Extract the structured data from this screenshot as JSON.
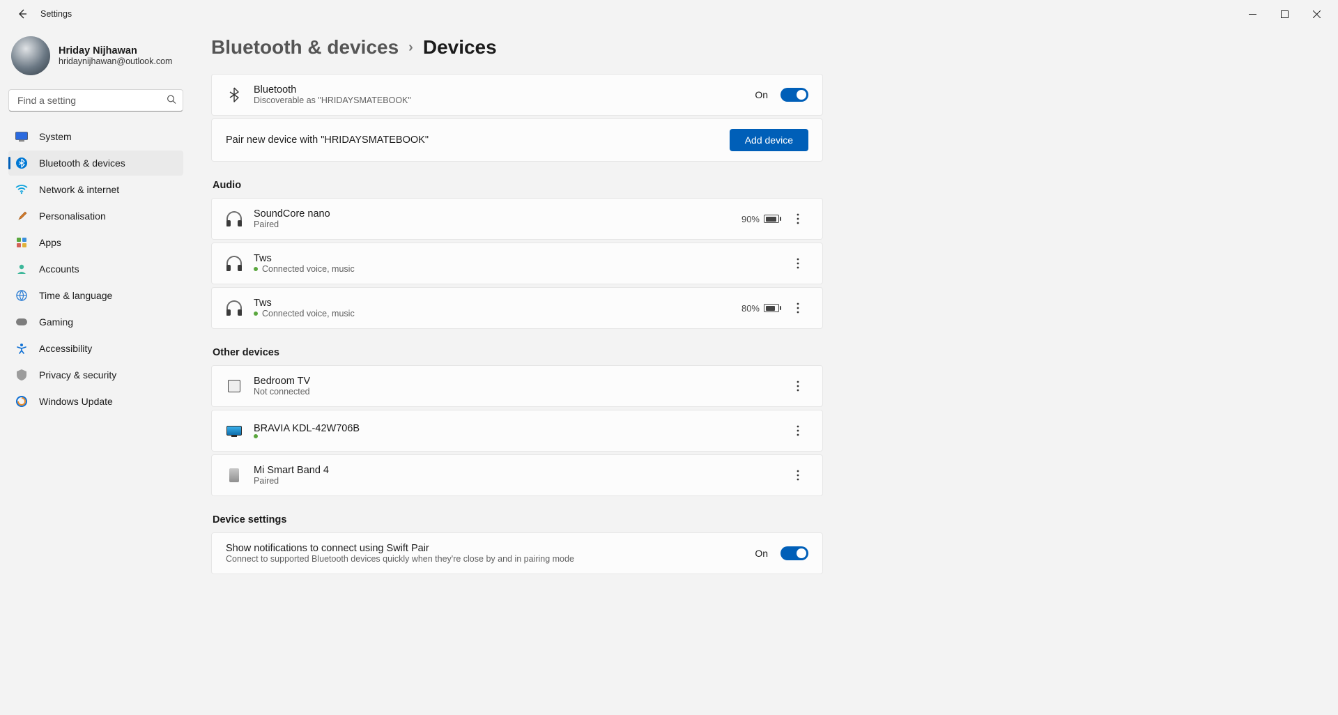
{
  "window": {
    "title": "Settings"
  },
  "profile": {
    "name": "Hriday Nijhawan",
    "email": "hridaynijhawan@outlook.com"
  },
  "search": {
    "placeholder": "Find a setting"
  },
  "sidebar": {
    "items": [
      {
        "label": "System"
      },
      {
        "label": "Bluetooth & devices"
      },
      {
        "label": "Network & internet"
      },
      {
        "label": "Personalisation"
      },
      {
        "label": "Apps"
      },
      {
        "label": "Accounts"
      },
      {
        "label": "Time & language"
      },
      {
        "label": "Gaming"
      },
      {
        "label": "Accessibility"
      },
      {
        "label": "Privacy & security"
      },
      {
        "label": "Windows Update"
      }
    ],
    "active_index": 1
  },
  "breadcrumb": {
    "parent": "Bluetooth & devices",
    "current": "Devices"
  },
  "bluetooth": {
    "title": "Bluetooth",
    "subtitle": "Discoverable as \"HRIDAYSMATEBOOK\"",
    "state_label": "On"
  },
  "pair": {
    "text": "Pair new device with \"HRIDAYSMATEBOOK\"",
    "button": "Add device"
  },
  "sections": {
    "audio_title": "Audio",
    "other_title": "Other devices",
    "settings_title": "Device settings"
  },
  "audio": [
    {
      "name": "SoundCore nano",
      "status": "Paired",
      "connected": false,
      "battery_label": "90%",
      "battery_pct": 90
    },
    {
      "name": "Tws",
      "status": "Connected voice, music",
      "connected": true,
      "battery_label": "",
      "battery_pct": null
    },
    {
      "name": "Tws",
      "status": "Connected voice, music",
      "connected": true,
      "battery_label": "80%",
      "battery_pct": 80
    }
  ],
  "other": [
    {
      "name": "Bedroom TV",
      "status": "Not connected",
      "connected": false,
      "icon": "cast"
    },
    {
      "name": "BRAVIA KDL-42W706B",
      "status": "",
      "connected": true,
      "icon": "tv"
    },
    {
      "name": "Mi Smart Band 4",
      "status": "Paired",
      "connected": false,
      "icon": "band"
    }
  ],
  "swift": {
    "title": "Show notifications to connect using Swift Pair",
    "subtitle": "Connect to supported Bluetooth devices quickly when they're close by and in pairing mode",
    "state_label": "On"
  }
}
